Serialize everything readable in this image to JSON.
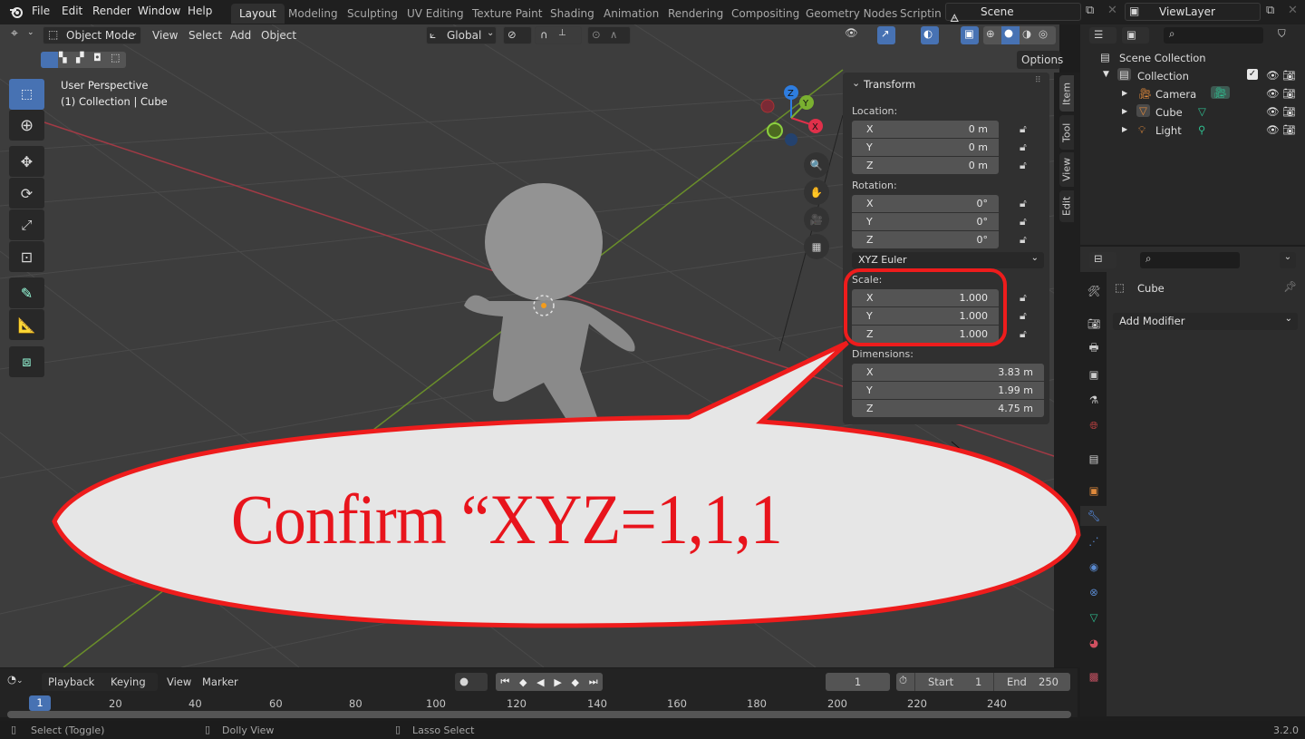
{
  "app": {
    "version": "3.2.0",
    "logo_icon": "blender-logo-icon"
  },
  "menu": [
    "File",
    "Edit",
    "Render",
    "Window",
    "Help"
  ],
  "workspaces": [
    "Layout",
    "Modeling",
    "Sculpting",
    "UV Editing",
    "Texture Paint",
    "Shading",
    "Animation",
    "Rendering",
    "Compositing",
    "Geometry Nodes",
    "Scripting"
  ],
  "active_workspace": "Layout",
  "scene": {
    "name": "Scene",
    "view_layer": "ViewLayer"
  },
  "viewport_header": {
    "mode": "Object Mode",
    "menus": [
      "View",
      "Select",
      "Add",
      "Object"
    ],
    "orientation": "Global",
    "options_label": "Options"
  },
  "viewport": {
    "perspective_label": "User Perspective",
    "context_label": "(1) Collection | Cube",
    "gizmo_axes": [
      "X",
      "Y",
      "Z"
    ]
  },
  "npanel": {
    "section": "Transform",
    "tabs": [
      "Item",
      "Tool",
      "View",
      "Edit"
    ],
    "active_tab": "Item",
    "location": {
      "label": "Location:",
      "x": "0 m",
      "y": "0 m",
      "z": "0 m"
    },
    "rotation": {
      "label": "Rotation:",
      "x": "0°",
      "y": "0°",
      "z": "0°"
    },
    "rotation_mode": "XYZ Euler",
    "scale": {
      "label": "Scale:",
      "x": "1.000",
      "y": "1.000",
      "z": "1.000"
    },
    "dimensions": {
      "label": "Dimensions:",
      "x": "3.83 m",
      "y": "1.99 m",
      "z": "4.75 m"
    },
    "axis": {
      "x": "X",
      "y": "Y",
      "z": "Z"
    }
  },
  "outliner": {
    "search_placeholder": "",
    "root": "Scene Collection",
    "collection": "Collection",
    "items": [
      {
        "name": "Camera",
        "icon": "camera-object-icon",
        "data_icon": "camera-data-icon"
      },
      {
        "name": "Cube",
        "icon": "mesh-object-icon",
        "data_icon": "mesh-data-icon"
      },
      {
        "name": "Light",
        "icon": "light-object-icon",
        "data_icon": "light-data-icon"
      }
    ]
  },
  "properties": {
    "object_name": "Cube",
    "add_modifier_label": "Add Modifier",
    "search_placeholder": "",
    "active_tab": "modifiers"
  },
  "timeline": {
    "menus": [
      "Playback",
      "Keying",
      "View",
      "Marker"
    ],
    "current_frame": "1",
    "start_label": "Start",
    "start": "1",
    "end_label": "End",
    "end": "250",
    "ticks": [
      "20",
      "40",
      "60",
      "80",
      "100",
      "120",
      "140",
      "160",
      "180",
      "200",
      "220",
      "240"
    ],
    "playhead": "1"
  },
  "statusbar": {
    "items": [
      "Select (Toggle)",
      "Dolly View",
      "Lasso Select"
    ],
    "version": "3.2.0"
  },
  "annotation": {
    "text": "Confirm “XYZ=1,1,1",
    "color": "#e8141c",
    "highlight_target": "scale-fields"
  }
}
